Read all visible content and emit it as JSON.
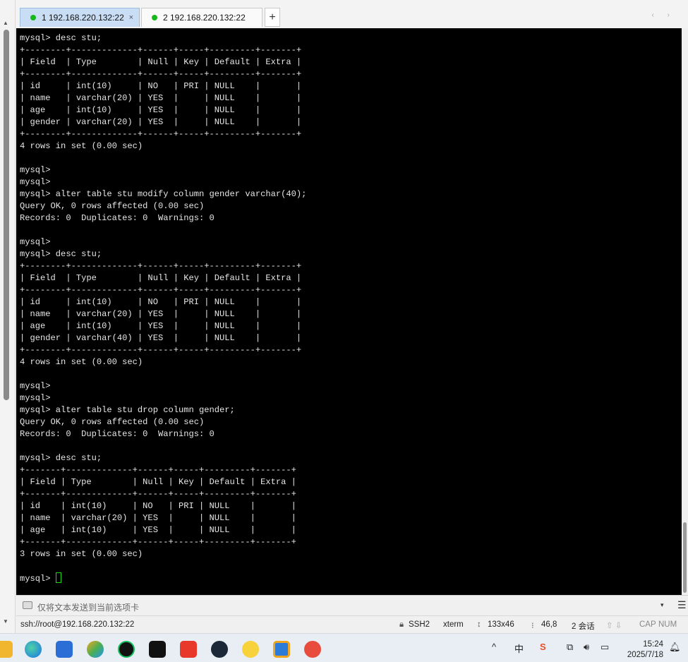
{
  "tabs": [
    {
      "label": "1 192.168.220.132:22",
      "active": true,
      "close": "×"
    },
    {
      "label": "2 192.168.220.132:22",
      "active": false,
      "close": ""
    }
  ],
  "tab_add": "+",
  "tab_nav": "‹ ›",
  "terminal_lines": [
    "mysql> desc stu;",
    "+--------+-------------+------+-----+---------+-------+",
    "| Field  | Type        | Null | Key | Default | Extra |",
    "+--------+-------------+------+-----+---------+-------+",
    "| id     | int(10)     | NO   | PRI | NULL    |       |",
    "| name   | varchar(20) | YES  |     | NULL    |       |",
    "| age    | int(10)     | YES  |     | NULL    |       |",
    "| gender | varchar(20) | YES  |     | NULL    |       |",
    "+--------+-------------+------+-----+---------+-------+",
    "4 rows in set (0.00 sec)",
    "",
    "mysql>",
    "mysql>",
    "mysql> alter table stu modify column gender varchar(40);",
    "Query OK, 0 rows affected (0.00 sec)",
    "Records: 0  Duplicates: 0  Warnings: 0",
    "",
    "mysql>",
    "mysql> desc stu;",
    "+--------+-------------+------+-----+---------+-------+",
    "| Field  | Type        | Null | Key | Default | Extra |",
    "+--------+-------------+------+-----+---------+-------+",
    "| id     | int(10)     | NO   | PRI | NULL    |       |",
    "| name   | varchar(20) | YES  |     | NULL    |       |",
    "| age    | int(10)     | YES  |     | NULL    |       |",
    "| gender | varchar(40) | YES  |     | NULL    |       |",
    "+--------+-------------+------+-----+---------+-------+",
    "4 rows in set (0.00 sec)",
    "",
    "mysql>",
    "mysql>",
    "mysql> alter table stu drop column gender;",
    "Query OK, 0 rows affected (0.00 sec)",
    "Records: 0  Duplicates: 0  Warnings: 0",
    "",
    "mysql> desc stu;",
    "+-------+-------------+------+-----+---------+-------+",
    "| Field | Type        | Null | Key | Default | Extra |",
    "+-------+-------------+------+-----+---------+-------+",
    "| id    | int(10)     | NO   | PRI | NULL    |       |",
    "| name  | varchar(20) | YES  |     | NULL    |       |",
    "| age   | int(10)     | YES  |     | NULL    |       |",
    "+-------+-------------+------+-----+---------+-------+",
    "3 rows in set (0.00 sec)",
    ""
  ],
  "prompt": "mysql> ",
  "sendbar": {
    "placeholder": "仅将文本发送到当前选项卡",
    "dropdown": "▾",
    "menu": "☰"
  },
  "status": {
    "connection": "ssh://root@192.168.220.132:22",
    "protocol": "SSH2",
    "terminal": "xterm",
    "size": "133x46",
    "position": "46,8",
    "sessions": "2 会话",
    "caps": "CAP",
    "num": "NUM"
  },
  "taskbar": {
    "icons": [
      "explorer-icon",
      "edge-icon",
      "store-icon",
      "settings-icon",
      "xbox-icon",
      "capcut-icon",
      "wps-icon",
      "steam-icon",
      "duck-icon",
      "box-icon",
      "snail-icon"
    ],
    "tray": {
      "chevron": "^",
      "ime": "中",
      "sogou": "S"
    },
    "time": "15:24",
    "date": "2025/7/18"
  },
  "colors": {
    "terminal_bg": "#000000",
    "terminal_fg": "#e6e6e6",
    "cursor": "#19d919",
    "tab_active": "#c9def5",
    "dot": "#16b81c"
  }
}
